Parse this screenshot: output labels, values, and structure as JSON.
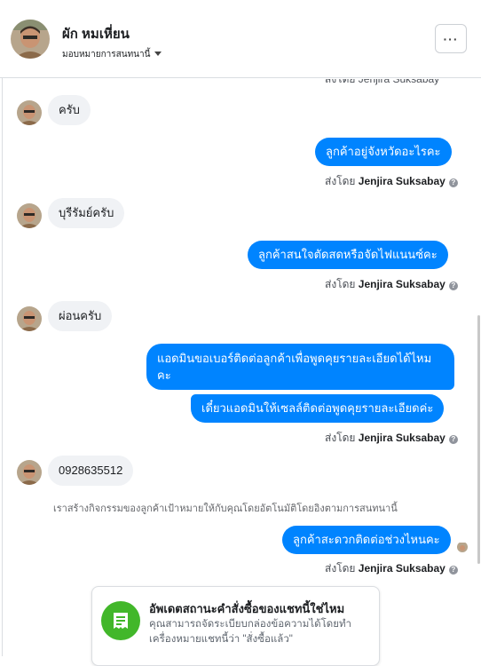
{
  "header": {
    "name": "ผัก หมเหี่ยน",
    "assign_label": "มอบหมายการสนทนานี้",
    "more_label": "···"
  },
  "messages": {
    "top_partial_sent_by": "ส่งโดย Jenjira Suksabay",
    "in_1": "ครับ",
    "out_1": "ลูกค้าอยู่จังหวัดอะไรคะ",
    "sent_by_prefix": "ส่งโดย",
    "agent_name": "Jenjira Suksabay",
    "in_2": "บุรีรัมย์ครับ",
    "out_2": "ลูกค้าสนใจตัดสดหรือจัดไฟแนนซ์คะ",
    "in_3": "ผ่อนครับ",
    "out_3a": "แอดมินขอเบอร์ติดต่อลูกค้าเพื่อพูดคุยรายละเอียดได้ไหมคะ",
    "out_3b": "เดี๋ยวแอดมินให้เซลล์ติดต่อพูดคุยรายละเอียดค่ะ",
    "in_4": "0928635512",
    "system_note": "เราสร้างกิจกรรมของลูกค้าเป้าหมายให้กับคุณโดยอัตโนมัติโดยอิงตามการสนทนานี้",
    "out_4": "ลูกค้าสะดวกติดต่อช่วงไหนคะ"
  },
  "card": {
    "title": "อัพเดตสถานะคำสั่งซื้อของแชทนี้ใช่ไหม",
    "body": "คุณสามารถจัดระเบียบกล่องข้อความได้โดยทำเครื่องหมายแชทนี้ว่า \"สั่งซื้อแล้ว\""
  },
  "colors": {
    "sent_bubble": "#0084ff",
    "received_bubble": "#f0f2f5",
    "card_icon": "#42b72a"
  },
  "icons": {
    "more": "more-icon",
    "info": "info-icon",
    "order": "order-icon",
    "caret": "caret-down-icon"
  }
}
